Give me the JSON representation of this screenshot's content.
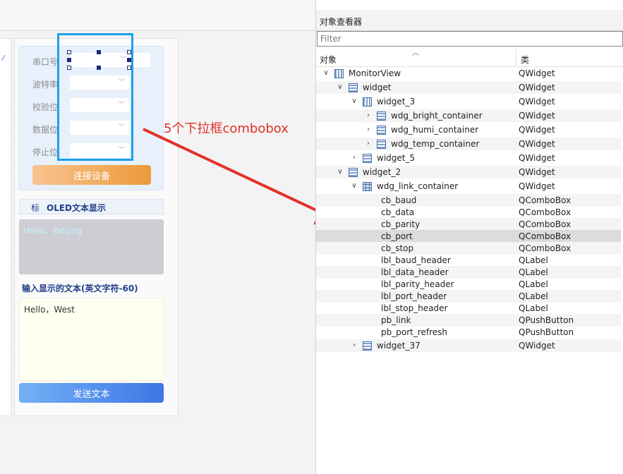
{
  "form": {
    "link_rows": [
      {
        "label": "串口号"
      },
      {
        "label": "波特率"
      },
      {
        "label": "校验位"
      },
      {
        "label": "数据位"
      },
      {
        "label": "停止位"
      }
    ],
    "connect_label": "连接设备",
    "oled_mark": "标",
    "oled_title": "OLED文本显示",
    "oled_text": "Hello，Beijing",
    "input_label": "输入显示的文本(英文字符-60)",
    "input_text": "Hello，West",
    "send_label": "发送文本",
    "annotation": "5个下拉框combobox",
    "colors": {
      "annotation": "#e2312a",
      "highlight": "#1aa1e6",
      "bracket": "#7dc83c"
    }
  },
  "inspector": {
    "title": "对象查看器",
    "filter_placeholder": "Filter",
    "col_object": "对象",
    "col_class": "类",
    "items": [
      {
        "name": "MonitorView",
        "cls": "QWidget",
        "depth": 0,
        "arrow": "down",
        "icon": "vbox-icon"
      },
      {
        "name": "widget",
        "cls": "QWidget",
        "depth": 1,
        "arrow": "down",
        "icon": "layout-icon"
      },
      {
        "name": "widget_3",
        "cls": "QWidget",
        "depth": 2,
        "arrow": "down",
        "icon": "vbox-icon"
      },
      {
        "name": "wdg_bright_container",
        "cls": "QWidget",
        "depth": 3,
        "arrow": "right",
        "icon": "layout-icon"
      },
      {
        "name": "wdg_humi_container",
        "cls": "QWidget",
        "depth": 3,
        "arrow": "right",
        "icon": "layout-icon"
      },
      {
        "name": "wdg_temp_container",
        "cls": "QWidget",
        "depth": 3,
        "arrow": "right",
        "icon": "layout-icon"
      },
      {
        "name": "widget_5",
        "cls": "QWidget",
        "depth": 2,
        "arrow": "right",
        "icon": "layout-icon"
      },
      {
        "name": "widget_2",
        "cls": "QWidget",
        "depth": 1,
        "arrow": "down",
        "icon": "layout-icon"
      },
      {
        "name": "wdg_link_container",
        "cls": "QWidget",
        "depth": 2,
        "arrow": "down",
        "icon": "grid-icon"
      },
      {
        "name": "cb_baud",
        "cls": "QComboBox",
        "depth": 3,
        "arrow": "none",
        "icon": "none"
      },
      {
        "name": "cb_data",
        "cls": "QComboBox",
        "depth": 3,
        "arrow": "none",
        "icon": "none"
      },
      {
        "name": "cb_parity",
        "cls": "QComboBox",
        "depth": 3,
        "arrow": "none",
        "icon": "none"
      },
      {
        "name": "cb_port",
        "cls": "QComboBox",
        "depth": 3,
        "arrow": "none",
        "icon": "none",
        "selected": true
      },
      {
        "name": "cb_stop",
        "cls": "QComboBox",
        "depth": 3,
        "arrow": "none",
        "icon": "none"
      },
      {
        "name": "lbl_baud_header",
        "cls": "QLabel",
        "depth": 3,
        "arrow": "none",
        "icon": "none"
      },
      {
        "name": "lbl_data_header",
        "cls": "QLabel",
        "depth": 3,
        "arrow": "none",
        "icon": "none"
      },
      {
        "name": "lbl_parity_header",
        "cls": "QLabel",
        "depth": 3,
        "arrow": "none",
        "icon": "none"
      },
      {
        "name": "lbl_port_header",
        "cls": "QLabel",
        "depth": 3,
        "arrow": "none",
        "icon": "none"
      },
      {
        "name": "lbl_stop_header",
        "cls": "QLabel",
        "depth": 3,
        "arrow": "none",
        "icon": "none"
      },
      {
        "name": "pb_link",
        "cls": "QPushButton",
        "depth": 3,
        "arrow": "none",
        "icon": "none"
      },
      {
        "name": "pb_port_refresh",
        "cls": "QPushButton",
        "depth": 3,
        "arrow": "none",
        "icon": "none"
      },
      {
        "name": "widget_37",
        "cls": "QWidget",
        "depth": 2,
        "arrow": "right",
        "icon": "layout-icon"
      }
    ]
  }
}
